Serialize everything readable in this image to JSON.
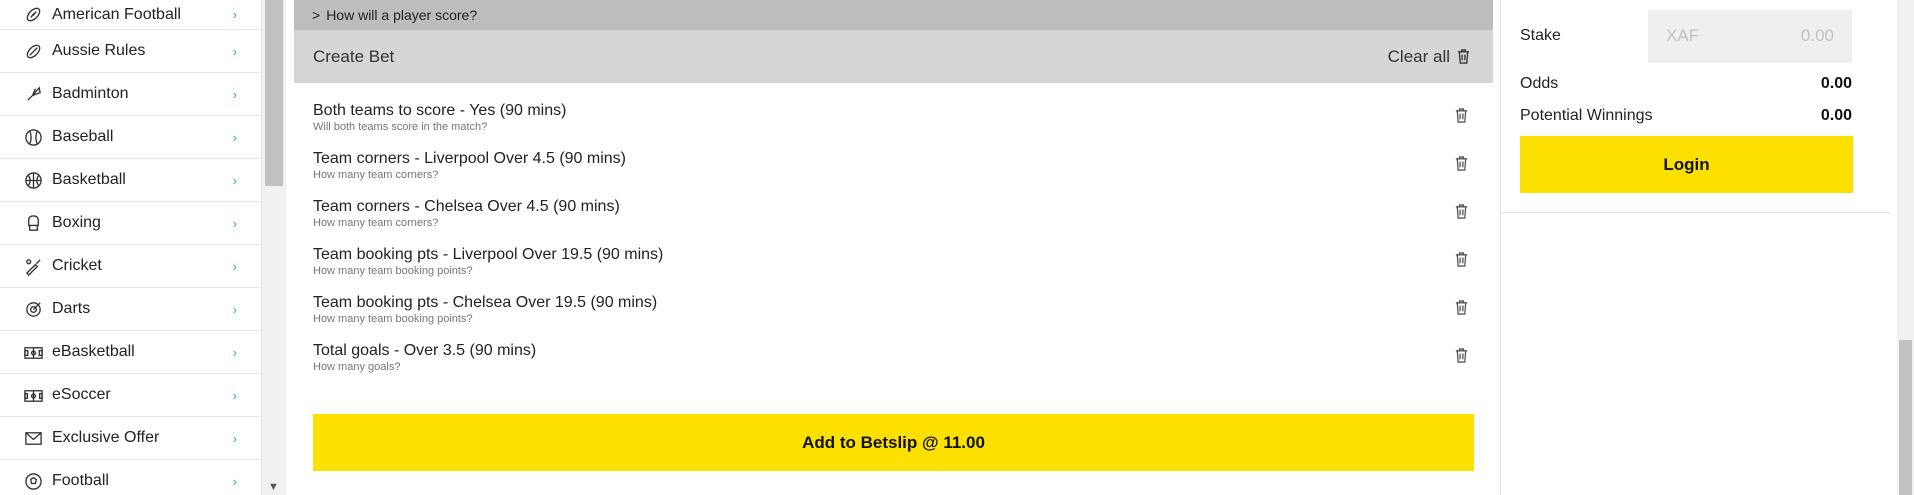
{
  "sidebar": {
    "items": [
      {
        "label": "American Football",
        "icon": "american-football-icon"
      },
      {
        "label": "Aussie Rules",
        "icon": "aussie-rules-icon"
      },
      {
        "label": "Badminton",
        "icon": "badminton-icon"
      },
      {
        "label": "Baseball",
        "icon": "baseball-icon"
      },
      {
        "label": "Basketball",
        "icon": "basketball-icon"
      },
      {
        "label": "Boxing",
        "icon": "boxing-glove-icon"
      },
      {
        "label": "Cricket",
        "icon": "cricket-bat-icon"
      },
      {
        "label": "Darts",
        "icon": "darts-icon"
      },
      {
        "label": "eBasketball",
        "icon": "ebasketball-icon"
      },
      {
        "label": "eSoccer",
        "icon": "esoccer-icon"
      },
      {
        "label": "Exclusive Offer",
        "icon": "envelope-icon"
      },
      {
        "label": "Football",
        "icon": "football-icon"
      }
    ]
  },
  "main": {
    "how_score": "How will a player score?",
    "create_bet_title": "Create Bet",
    "clear_all": "Clear all",
    "bets": [
      {
        "name": "Both teams to score - Yes (90 mins)",
        "question": "Will both teams score in the match?"
      },
      {
        "name": "Team corners - Liverpool Over 4.5 (90 mins)",
        "question": "How many team corners?"
      },
      {
        "name": "Team corners - Chelsea Over 4.5 (90 mins)",
        "question": "How many team corners?"
      },
      {
        "name": "Team booking pts - Liverpool Over 19.5 (90 mins)",
        "question": "How many team booking points?"
      },
      {
        "name": "Team booking pts - Chelsea Over 19.5 (90 mins)",
        "question": "How many team booking points?"
      },
      {
        "name": "Total goals - Over 3.5 (90 mins)",
        "question": "How many goals?"
      }
    ],
    "add_betslip": "Add to Betslip @ 11.00"
  },
  "betslip": {
    "stake_label": "Stake",
    "currency": "XAF",
    "stake_value": "0.00",
    "odds_label": "Odds",
    "odds_value": "0.00",
    "winnings_label": "Potential Winnings",
    "winnings_value": "0.00",
    "login": "Login"
  },
  "colors": {
    "accent_yellow": "#fce100",
    "chevron_green": "#2bb39b",
    "header_grey": "#d6d6d6"
  }
}
